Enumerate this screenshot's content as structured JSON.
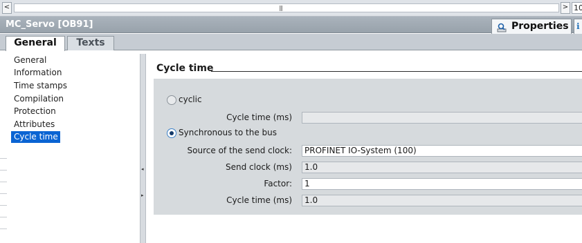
{
  "scrollbar": {
    "left_arrow": "<",
    "grip": "|||",
    "right_arrow": ">",
    "value": "10"
  },
  "window": {
    "title": "MC_Servo [OB91]"
  },
  "inspector_tabs": {
    "properties_label": "Properties",
    "info_icon": "info-icon"
  },
  "tabs": [
    {
      "label": "General",
      "active": true
    },
    {
      "label": "Texts",
      "active": false
    }
  ],
  "nav": {
    "items": [
      "General",
      "Information",
      "Time stamps",
      "Compilation",
      "Protection",
      "Attributes",
      "Cycle time"
    ],
    "selected": "Cycle time"
  },
  "section": {
    "title": "Cycle time"
  },
  "form": {
    "cyclic_label": "cyclic",
    "cyclic_selected": false,
    "cycle_time_label_1": "Cycle time (ms)",
    "cycle_time_value_1": "",
    "sync_label": "Synchronous to the bus",
    "sync_selected": true,
    "source_label": "Source of the send clock:",
    "source_value": "PROFINET IO-System (100)",
    "send_clock_label": "Send clock (ms)",
    "send_clock_value": "1.0",
    "factor_label": "Factor:",
    "factor_value": "1",
    "cycle_time_label_2": "Cycle time (ms)",
    "cycle_time_value_2": "1.0"
  },
  "colors": {
    "selection": "#0a64d3",
    "titlebar": "#9ea8b1",
    "panel": "#d6dadd"
  }
}
